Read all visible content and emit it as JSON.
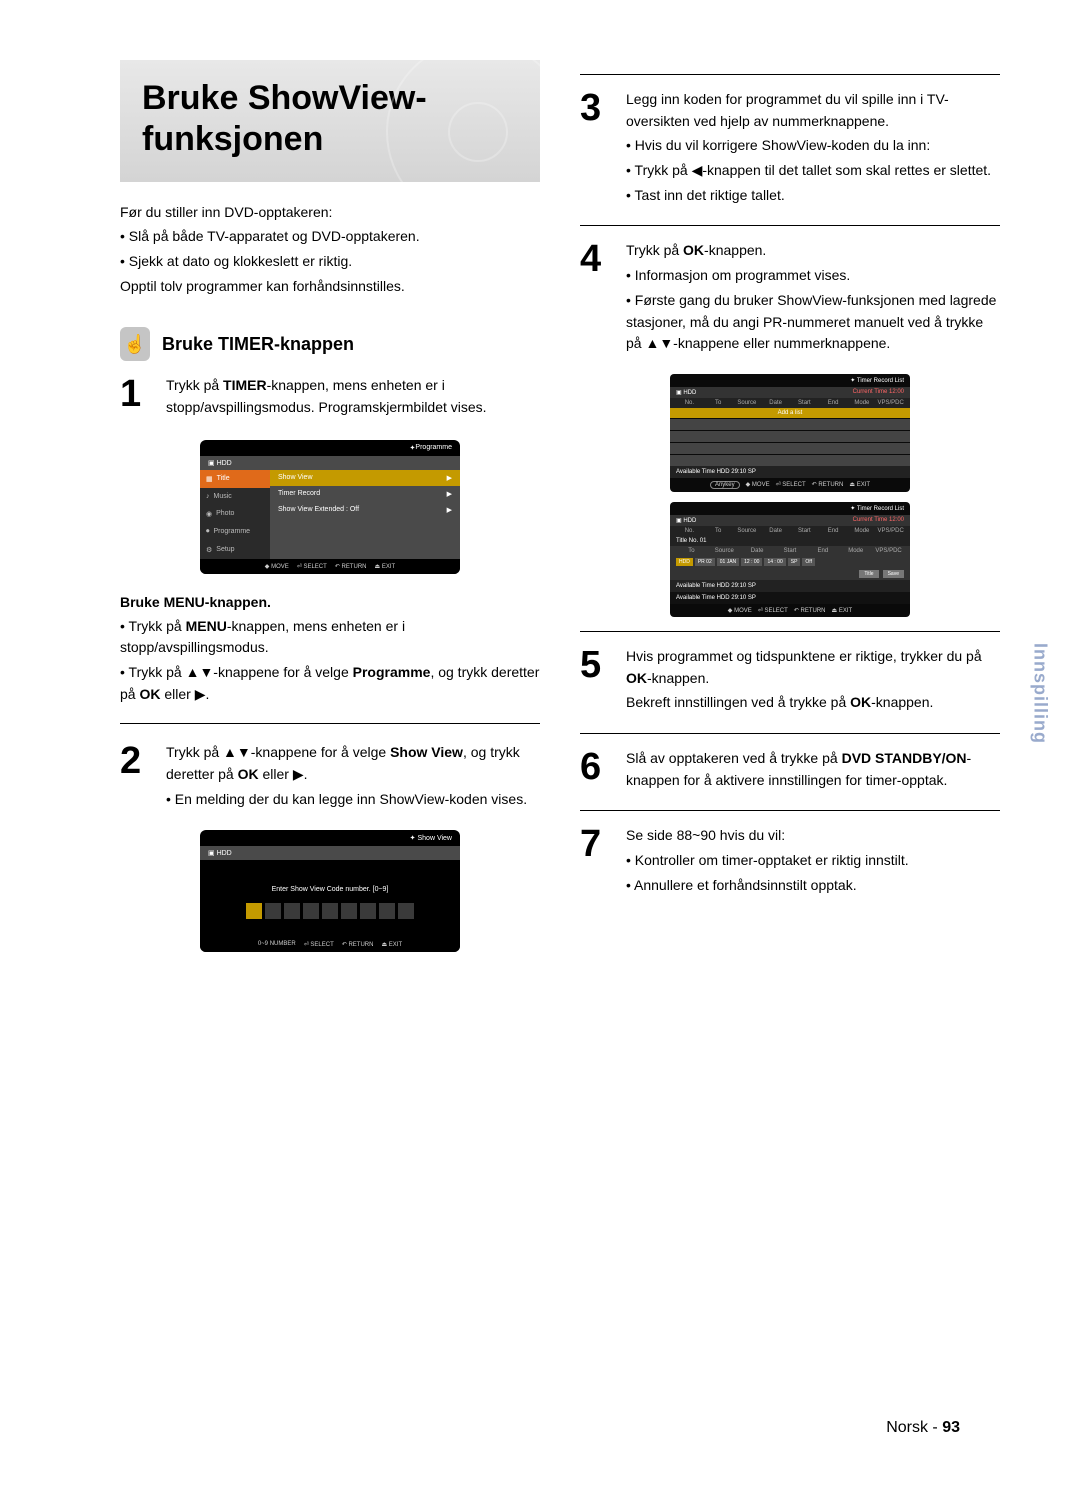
{
  "title_line1": "Bruke ShowView-",
  "title_line2": "funksjonen",
  "intro": {
    "l1": "Før du stiller inn DVD-opptakeren:",
    "l2": "• Slå på både TV-apparatet og DVD-opptakeren.",
    "l3": "• Sjekk at dato og klokkeslett er riktig.",
    "l4": "Opptil tolv programmer kan forhåndsinnstilles."
  },
  "section_title": "Bruke TIMER-knappen",
  "step1": {
    "num": "1",
    "l1a": "Trykk på ",
    "l1b": "TIMER",
    "l1c": "-knappen, mens enheten er i stopp/avspillingsmodus. Programskjermbildet vises."
  },
  "osd1": {
    "header": "Programme",
    "hdd": "HDD",
    "menu": [
      "Title",
      "Music",
      "Photo",
      "Programme",
      "Setup"
    ],
    "rows": [
      {
        "label": "Show View",
        "arrow": "▶"
      },
      {
        "label": "Timer Record",
        "arrow": "▶"
      },
      {
        "label": "Show View Extended  : Off",
        "arrow": "▶"
      }
    ],
    "foot": [
      "MOVE",
      "SELECT",
      "RETURN",
      "EXIT"
    ]
  },
  "menu_sub": {
    "head": "Bruke MENU-knappen.",
    "l1a": "• Trykk på ",
    "l1b": "MENU",
    "l1c": "-knappen, mens enheten er i stopp/avspillingsmodus.",
    "l2a": "• Trykk på ▲▼-knappene for å velge ",
    "l2b": "Programme",
    "l2c": ", og trykk deretter på ",
    "l2d": "OK",
    "l2e": " eller ▶."
  },
  "step2": {
    "num": "2",
    "l1a": "Trykk på ▲▼-knappene for å velge ",
    "l1b": "Show View",
    "l1c": ", og trykk deretter på ",
    "l1d": "OK",
    "l1e": " eller ▶.",
    "l2": "• En melding der du kan legge inn ShowView-koden vises."
  },
  "osd2": {
    "header": "Show View",
    "hdd": "HDD",
    "msg": "Enter Show View Code number. [0~9]",
    "foot": [
      "0~9 NUMBER",
      "SELECT",
      "RETURN",
      "EXIT"
    ]
  },
  "step3": {
    "num": "3",
    "l1": "Legg inn koden for programmet du vil spille inn i TV-oversikten ved hjelp av nummerknappene.",
    "l2": "• Hvis du vil korrigere ShowView-koden du la inn:",
    "l3": "• Trykk på ◀-knappen til det tallet som skal rettes er slettet.",
    "l4": "• Tast inn det riktige tallet."
  },
  "step4": {
    "num": "4",
    "l1a": "Trykk på ",
    "l1b": "OK",
    "l1c": "-knappen.",
    "l2": "• Informasjon om programmet vises.",
    "l3": "• Første gang du bruker ShowView-funksjonen med lagrede stasjoner, må du angi PR-nummeret manuelt ved å trykke på ▲▼-knappene eller nummerknappene."
  },
  "osd3a": {
    "header": "Timer Record List",
    "hdd": "HDD",
    "time": "Current Time 12:00",
    "cols": [
      "No.",
      "To",
      "Source",
      "Date",
      "Start",
      "End",
      "Mode",
      "VPS/PDC"
    ],
    "add": "Add a list",
    "avail": "Available Time        HDD    29:10  SP",
    "anykey": "Anykey",
    "foot": [
      "MOVE",
      "SELECT",
      "RETURN",
      "EXIT"
    ]
  },
  "osd3b": {
    "header": "Timer Record List",
    "hdd": "HDD",
    "time": "Current Time 12:00",
    "cols": [
      "No.",
      "To",
      "Source",
      "Date",
      "Start",
      "End",
      "Mode",
      "VPS/PDC"
    ],
    "title_no": "Title No. 01",
    "edit_cols": [
      "To",
      "Source",
      "Date",
      "Start",
      "End",
      "Mode",
      "VPS/PDC"
    ],
    "edit_vals": [
      "HDD",
      "PR 02",
      "01 JAN",
      "12 : 00",
      "14 : 00",
      "SP",
      "Off"
    ],
    "btn_title": "Title",
    "btn_save": "Save",
    "avail": "Available Time        HDD    29:10  SP",
    "avail2": "Available Time        HDD    29:10  SP",
    "foot": [
      "MOVE",
      "SELECT",
      "RETURN",
      "EXIT"
    ]
  },
  "step5": {
    "num": "5",
    "l1a": "Hvis programmet og tidspunktene er riktige, trykker du på ",
    "l1b": "OK",
    "l1c": "-knappen.",
    "l2a": "Bekreft innstillingen ved å trykke på ",
    "l2b": "OK",
    "l2c": "-knappen."
  },
  "step6": {
    "num": "6",
    "l1a": "Slå av opptakeren ved å trykke på ",
    "l1b": "DVD STANDBY/ON",
    "l1c": "-knappen for å aktivere innstillingen for timer-opptak."
  },
  "step7": {
    "num": "7",
    "l1": "Se side 88~90 hvis du vil:",
    "l2": "• Kontroller om timer-opptaket er riktig innstilt.",
    "l3": "• Annullere et forhåndsinnstilt opptak."
  },
  "side_tab": "Innspilling",
  "footer": {
    "lang": "Norsk",
    "sep": " - ",
    "page": "93"
  }
}
